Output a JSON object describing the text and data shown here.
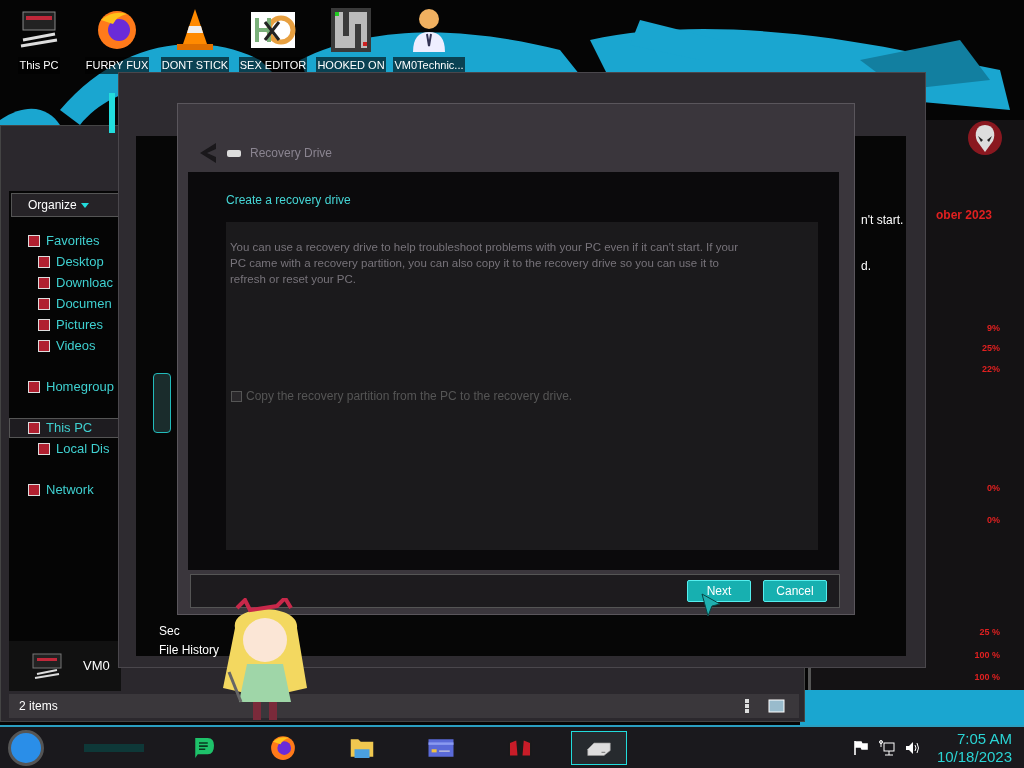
{
  "desktop_icons": [
    {
      "kind": "pc",
      "label": "This PC"
    },
    {
      "kind": "firefox",
      "label": "FURRY FUX"
    },
    {
      "kind": "cone",
      "label": "DONT STICK"
    },
    {
      "kind": "hex",
      "label": "SEX EDITOR"
    },
    {
      "kind": "maze",
      "label": "HOOKED ON"
    },
    {
      "kind": "person",
      "label": "VM0Technic..."
    }
  ],
  "explorer": {
    "organize": "Organize",
    "nav": [
      {
        "label": "Favorites",
        "selected": false,
        "children": [
          {
            "label": "Desktop",
            "selected": false
          },
          {
            "label": "Downloac",
            "selected": false
          },
          {
            "label": "Documen",
            "selected": false
          },
          {
            "label": "Pictures",
            "selected": false
          },
          {
            "label": "Videos",
            "selected": false
          }
        ]
      },
      {
        "label": "Homegroup",
        "selected": false
      },
      {
        "label": "This PC",
        "selected": true,
        "children": [
          {
            "label": "Local Dis",
            "selected": false
          }
        ]
      },
      {
        "label": "Network",
        "selected": false
      }
    ],
    "item_label": "VM0",
    "status": "2 items"
  },
  "control_panel": {
    "links": [
      "Sec",
      "File History"
    ],
    "fragments": [
      "n't start.",
      "d."
    ]
  },
  "gadget": {
    "date": "ober 2023",
    "readings": [
      "9%",
      "25%",
      "22%",
      "0%",
      "0%",
      "25 %",
      "100 %",
      "100 %"
    ]
  },
  "dialog": {
    "title": "Recovery Drive",
    "heading": "Create a recovery drive",
    "description": "You can use a recovery drive to help troubleshoot problems with your PC even if it can't start. If your PC came with a recovery partition, you can also copy it to the recovery drive so you can use it to refresh or reset your PC.",
    "checkbox": {
      "label": "Copy the recovery partition from the PC to the recovery drive.",
      "checked": false,
      "disabled": true
    },
    "buttons": [
      "Next",
      "Cancel"
    ]
  },
  "taskbar": {
    "apps": [
      {
        "kind": "chat",
        "selected": false
      },
      {
        "kind": "firefox",
        "selected": false
      },
      {
        "kind": "folder",
        "selected": false
      },
      {
        "kind": "card",
        "selected": false
      },
      {
        "kind": "gadget",
        "selected": false
      },
      {
        "kind": "drive",
        "selected": true
      }
    ],
    "time": "7:05 AM",
    "date": "10/18/2023"
  }
}
